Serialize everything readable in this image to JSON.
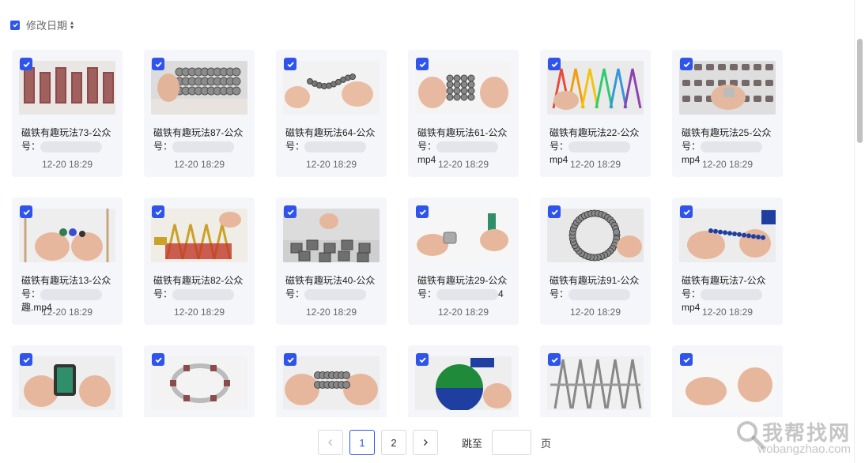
{
  "toolbar": {
    "sort_label": "修改日期"
  },
  "items": [
    {
      "title_prefix": "磁铁有趣玩法73-公众号：",
      "title_suffix": "",
      "date": "12-20 18:29",
      "thumb": "magnet-rods-red"
    },
    {
      "title_prefix": "磁铁有趣玩法87-公众号：",
      "title_suffix": "",
      "date": "12-20 18:29",
      "thumb": "magnet-spheres-silver"
    },
    {
      "title_prefix": "磁铁有趣玩法64-公众号：",
      "title_suffix": "",
      "date": "12-20 18:29",
      "thumb": "magnet-chain-hands"
    },
    {
      "title_prefix": "磁铁有趣玩法61-公众号：",
      "title_suffix": "mp4",
      "date": "12-20 18:29",
      "thumb": "magnet-cylinder-hands"
    },
    {
      "title_prefix": "磁铁有趣玩法22-公众号：",
      "title_suffix": "mp4",
      "date": "12-20 18:29",
      "thumb": "magnet-rainbow-frame"
    },
    {
      "title_prefix": "磁铁有趣玩法25-公众号：",
      "title_suffix": "mp4",
      "date": "12-20 18:29",
      "thumb": "magnet-grid-hands"
    },
    {
      "title_prefix": "磁铁有趣玩法13-公众号：",
      "title_suffix": "趣.mp4",
      "date": "12-20 18:29",
      "thumb": "magnet-colored-hands"
    },
    {
      "title_prefix": "磁铁有趣玩法82-公众号：",
      "title_suffix": "",
      "date": "12-20 18:29",
      "thumb": "magnet-gold-tower"
    },
    {
      "title_prefix": "磁铁有趣玩法40-公众号：",
      "title_suffix": "",
      "date": "12-20 18:29",
      "thumb": "magnet-cubes-table"
    },
    {
      "title_prefix": "磁铁有趣玩法29-公众号：",
      "title_suffix": "4",
      "date": "12-20 18:29",
      "thumb": "magnet-cylinder-pull"
    },
    {
      "title_prefix": "磁铁有趣玩法91-公众号：",
      "title_suffix": "",
      "date": "12-20 18:29",
      "thumb": "magnet-sphere-shell"
    },
    {
      "title_prefix": "磁铁有趣玩法7-公众号：",
      "title_suffix": "mp4",
      "date": "12-20 18:29",
      "thumb": "magnet-blue-chain"
    },
    {
      "thumb": "magnet-device-hands"
    },
    {
      "thumb": "magnet-ring-coil"
    },
    {
      "thumb": "magnet-ball-snake"
    },
    {
      "thumb": "magnet-globe-color"
    },
    {
      "thumb": "magnet-rod-arch"
    },
    {
      "thumb": "magnet-hands-white"
    }
  ],
  "pagination": {
    "prev_icon": "chevron-left-icon",
    "pages": [
      "1",
      "2"
    ],
    "active_page": "1",
    "next_icon": "chevron-right-icon",
    "jump_label": "跳至",
    "jump_value": "",
    "page_suffix": "页"
  },
  "watermark": {
    "main": "我帮找网",
    "sub": "wobangzhao.com"
  },
  "colors": {
    "accent": "#2f54eb",
    "card_bg": "#f5f6fa"
  }
}
